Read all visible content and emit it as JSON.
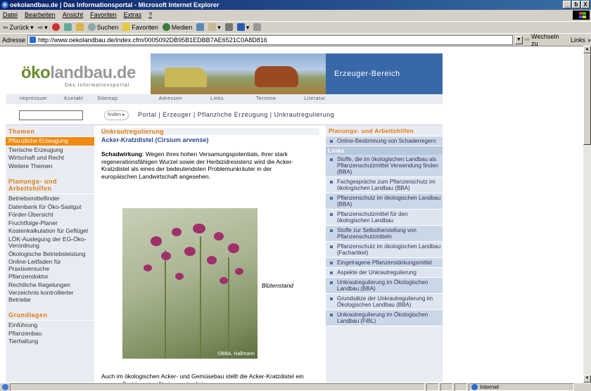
{
  "window": {
    "title": "oekolandbau.de | Das Informationsportal - Microsoft Internet Explorer",
    "controls": [
      "_",
      "ƀ",
      "X"
    ]
  },
  "menubar": [
    "Datei",
    "Bearbeiten",
    "Ansicht",
    "Favoriten",
    "Extras",
    "?"
  ],
  "toolbar": {
    "back": "Zurück",
    "search": "Suchen",
    "favorites": "Favoriten",
    "media": "Medien"
  },
  "addressbar": {
    "label": "Adresse",
    "url": "http://www.oekolandbau.de/index.cfm/0005092DB95B1EDBB7AE6521C0A8D816",
    "go": "Wechseln zu",
    "links": "Links"
  },
  "site": {
    "logo_main": "landbau.de",
    "logo_prefix": "ö",
    "logo_prefix_rest": "ko",
    "logo_sub": "Das Informationsportal",
    "section": "Erzeuger-Bereich",
    "topnav": [
      "Impressum",
      "Kontakt",
      "Sitemap",
      "Adressen",
      "Links",
      "Termine",
      "Literatur"
    ],
    "find_button": "finden ▸",
    "breadcrumb": "Portal  |  Erzeuger  |  Pflanzliche Erzeugung  |  Unkrautregulierung"
  },
  "left": {
    "themen_head": "Themen",
    "themen": [
      "Pflanzliche Erzeugung",
      "Tierische Erzeugung",
      "Wirtschaft und Recht",
      "Weitere Themen"
    ],
    "planungs_head_1": "Planungs- und",
    "planungs_head_2": "Arbeitshilfen",
    "planungs": [
      "Betriebsmittelfinder",
      "Datenbank für Öko-Saatgut",
      "Förder-Übersicht",
      "Fruchtfolge-Planer",
      "Kostenkalkulation für Geflügel",
      "LÖK-Auslegung der EG-Öko-Verordnung",
      "Ökologische Betriebsleistung",
      "Online-Leitfaden für Praxisversuche",
      "Pflanzendoktor",
      "Rechtliche Regelungen",
      "Verzeichnis kontrollierter Betriebe"
    ],
    "grundlagen_head": "Grundlagen",
    "grundlagen": [
      "Einführung",
      "Pflanzenbau",
      "Tierhaltung"
    ]
  },
  "main": {
    "heading": "Unkrautregulierung",
    "subheading": "Acker-Kratzdistel (Cirsium arvense)",
    "lead_bold": "Schadwirkung",
    "lead_text": ": Wegen ihres hohen Versamungspotentials, ihrer stark regenerationsfähigen Wurzel sowie der Herbizidresistenz wird die Acker-Kratzdistel als eines der bedeutendsten Problemunkräuter in der europäischen Landwirtschaft angesehen.",
    "caption": "Blütenstand",
    "photo_credit": "©BBA, Hallmann",
    "para2": "Auch im ökologischen Acker- und Gemüsebau stellt die Acker-Kratzdistel ein ernstes Problem dar. Sie kann sämtliche"
  },
  "right": {
    "head1": "Planungs- und Arbeitshilfen",
    "items1": [
      "Online-Bestimmung von Schaderregern"
    ],
    "head2": "Links",
    "items2": [
      "Stoffe, die im ökologischen Landbau als Pflanzenschutzmittel Verwendung finden (BBA)",
      "Fachgespräche zum Pflanzenschutz im ökologischen Landbau (BBA)",
      "Pflanzenschutz im ökologischen Landbau (BBA)",
      "Pflanzenschutzmittel für den ökologischen Landbau",
      "Stoffe zur Selbstherstellung von Pflanzenschutzmitteln",
      "Pflanzenschutz im ökologischen Landbau (Fachartikel)",
      "Eingetragene Pflanzenstärkungsmittel",
      "Aspekte der Unkrautregulierung",
      "Unkrautregulierung im Ökologischen Landbau (BBA)",
      "Grundsätze der Unkrautregulierung im Ökologischen Landbau (BBA)",
      "Unkrautregulierung im Ökologischen Landbau (FiBL)"
    ]
  },
  "status": {
    "zone": "Internet"
  }
}
